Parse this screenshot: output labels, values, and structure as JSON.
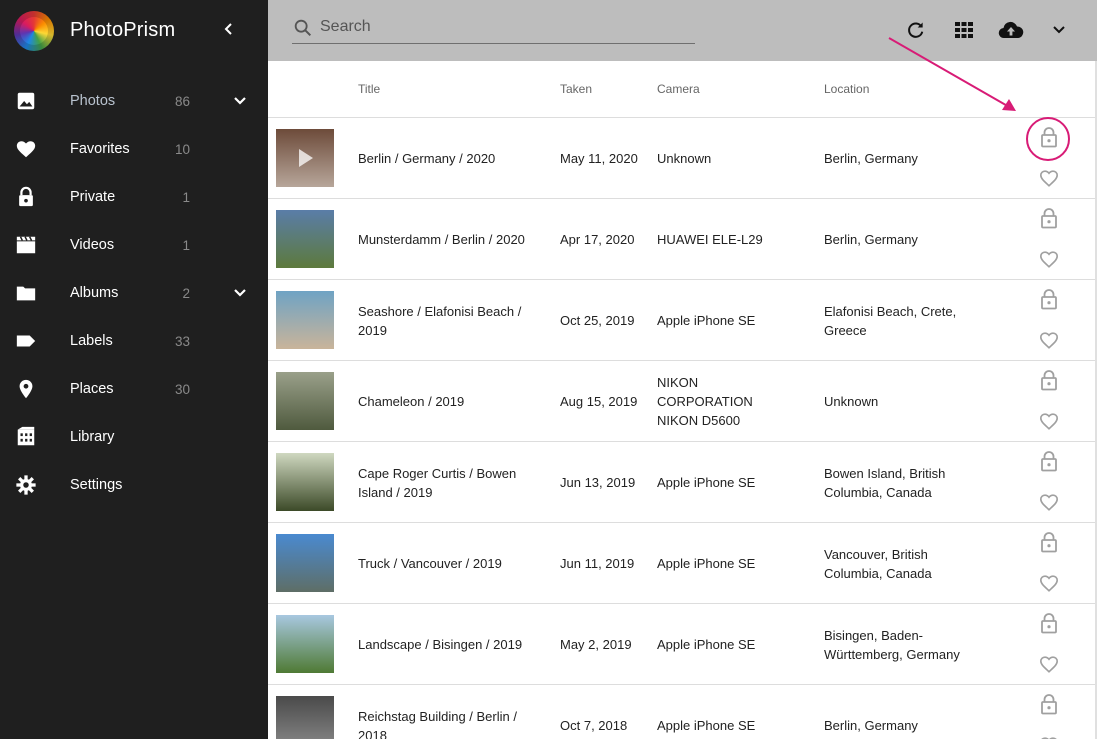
{
  "app": {
    "name": "PhotoPrism"
  },
  "sidebar": {
    "items": [
      {
        "label": "Photos",
        "count": "86",
        "icon": "image-icon",
        "expandable": true,
        "active": true
      },
      {
        "label": "Favorites",
        "count": "10",
        "icon": "heart-icon"
      },
      {
        "label": "Private",
        "count": "1",
        "icon": "lock-icon"
      },
      {
        "label": "Videos",
        "count": "1",
        "icon": "clapperboard-icon"
      },
      {
        "label": "Albums",
        "count": "2",
        "icon": "folder-icon",
        "expandable": true
      },
      {
        "label": "Labels",
        "count": "33",
        "icon": "label-tag-icon"
      },
      {
        "label": "Places",
        "count": "30",
        "icon": "map-pin-icon"
      },
      {
        "label": "Library",
        "count": "",
        "icon": "library-icon"
      },
      {
        "label": "Settings",
        "count": "",
        "icon": "gear-icon"
      }
    ]
  },
  "search": {
    "placeholder": "Search",
    "value": ""
  },
  "toolbar": {
    "icons": [
      "refresh-icon",
      "grid-view-icon",
      "upload-cloud-icon",
      "chevron-down-icon"
    ]
  },
  "table": {
    "headers": {
      "title": "Title",
      "taken": "Taken",
      "camera": "Camera",
      "location": "Location"
    },
    "rows": [
      {
        "title": "Berlin / Germany / 2020",
        "taken": "May 11, 2020",
        "camera": "Unknown",
        "location": "Berlin, Germany",
        "thumb_colors": [
          "#6d4b3a",
          "#b7a69a"
        ],
        "video": true
      },
      {
        "title": "Munsterdamm / Berlin / 2020",
        "taken": "Apr 17, 2020",
        "camera": "HUAWEI ELE-L29",
        "location": "Berlin, Germany",
        "thumb_colors": [
          "#5a7da8",
          "#5d7a3c"
        ]
      },
      {
        "title": "Seashore / Elafonisi Beach / 2019",
        "taken": "Oct 25, 2019",
        "camera": "Apple iPhone SE",
        "location": "Elafonisi Beach, Crete, Greece",
        "thumb_colors": [
          "#6fa3c4",
          "#c9b49a"
        ]
      },
      {
        "title": "Chameleon / 2019",
        "taken": "Aug 15, 2019",
        "camera": "NIKON CORPORATION NIKON D5600",
        "location": "Unknown",
        "thumb_colors": [
          "#9aa08a",
          "#4f5a3e"
        ]
      },
      {
        "title": "Cape Roger Curtis / Bowen Island / 2019",
        "taken": "Jun 13, 2019",
        "camera": "Apple iPhone SE",
        "location": "Bowen Island, British Columbia, Canada",
        "thumb_colors": [
          "#cfd8c0",
          "#3c4a28"
        ]
      },
      {
        "title": "Truck / Vancouver / 2019",
        "taken": "Jun 11, 2019",
        "camera": "Apple iPhone SE",
        "location": "Vancouver, British Columbia, Canada",
        "thumb_colors": [
          "#4a8ad0",
          "#5e6e66"
        ]
      },
      {
        "title": "Landscape / Bisingen / 2019",
        "taken": "May 2, 2019",
        "camera": "Apple iPhone SE",
        "location": "Bisingen, Baden-Württemberg, Germany",
        "thumb_colors": [
          "#a8c8e0",
          "#4f7a34"
        ]
      },
      {
        "title": "Reichstag Building / Berlin / 2018",
        "taken": "Oct 7, 2018",
        "camera": "Apple iPhone SE",
        "location": "Berlin, Germany",
        "thumb_colors": [
          "#4a4a4a",
          "#8f8f8f"
        ]
      }
    ]
  },
  "colors": {
    "sidebar_bg": "#1f1f1f",
    "toolbar_bg": "#bdbdbd",
    "highlight": "#d81b76",
    "action_icon": "#9e9e9e"
  }
}
